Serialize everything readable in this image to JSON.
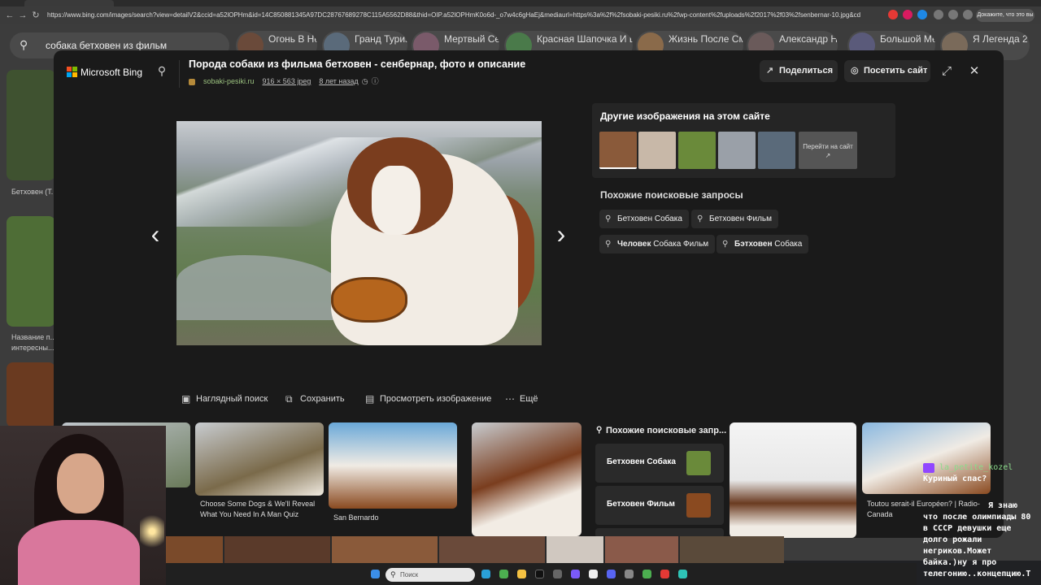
{
  "browser": {
    "url": "https://www.bing.com/images/search?view=detailV2&ccid=a52lOPHm&id=14C850881345A97DC28767689278C115A5562D88&thid=OIP.a52lOPHmK0o6d-_o7w4c6gHaEj&mediaurl=https%3a%2f%2fsobaki-pesiki.ru%2fwp-content%2fuploads%2f2017%2f03%2fsenbernar-10.jpg&cdnurl=https%3a%2f%2fth.bing.co...",
    "profile_button": "Докажите, что это вы"
  },
  "background": {
    "search_query": "собака бетховен из фильм",
    "chips": [
      "Огонь В Небе",
      "Гранд Туризмо",
      "Мертвый Сезон",
      "Красная Шапочка И Волк",
      "Жизнь После Смерти",
      "Александр Невский",
      "Большой Мельни...",
      "Я Легенда 2"
    ],
    "captions": [
      "Бетховен (Т...",
      "Название п...",
      "интересны..."
    ]
  },
  "modal": {
    "logo_text": "Microsoft Bing",
    "title": "Порода собаки из фильма бетховен - сенбернар, фото и описание",
    "source_site": "sobaki-pesiki.ru",
    "dimensions": "916 × 563 jpeg",
    "age": "8 лет назад",
    "share_label": "Поделиться",
    "visit_label": "Посетить сайт",
    "other_images_title": "Другие изображения на этом сайте",
    "visit_thumb_label": "Перейти на сайт",
    "related_title": "Похожие поисковые запросы",
    "related": [
      {
        "bold": "",
        "text": "Бетховен Собака"
      },
      {
        "bold": "",
        "text": "Бетховен Фильм"
      },
      {
        "bold": "Человек",
        "text": " Собака Фильм"
      },
      {
        "bold": "Бэтховен",
        "text": " Собака"
      }
    ],
    "actions": [
      "Наглядный поиск",
      "Сохранить",
      "Просмотреть изображение",
      "Ещё"
    ]
  },
  "grid": {
    "captions": [
      "Choose Some Dogs & We'll Reveal",
      "What You Need In A Man Quiz",
      "San Bernardo",
      "Toutou serait-il Européen? | Radio-",
      "Canada"
    ],
    "related_panel_title": "Похожие поисковые запр...",
    "related_panel_items": [
      "Бетховен Собака",
      "Бетховен Фильм"
    ]
  },
  "chat": {
    "user1": "la_petite_kozel",
    "msg1": "Куриный спас?",
    "msg2_lines": [
      "Я знаю",
      "что после олимпиады 80",
      "в СССР девушки еще",
      "долго рожали",
      "негриков.Может",
      "байка.)ну я про",
      "телегонию..концепцию.Т"
    ]
  },
  "taskbar": {
    "search_placeholder": "Поиск"
  },
  "colors": {
    "modal_bg": "#1a1a1a",
    "accent_site": "#9bc17f",
    "chat_user": "#8adb8a"
  },
  "icons": [
    "search-icon",
    "share-icon",
    "globe-icon",
    "expand-icon",
    "close-icon",
    "chevron-left-icon",
    "chevron-right-icon",
    "visual-search-icon",
    "save-icon",
    "view-image-icon",
    "more-icon",
    "info-icon",
    "history-icon"
  ]
}
